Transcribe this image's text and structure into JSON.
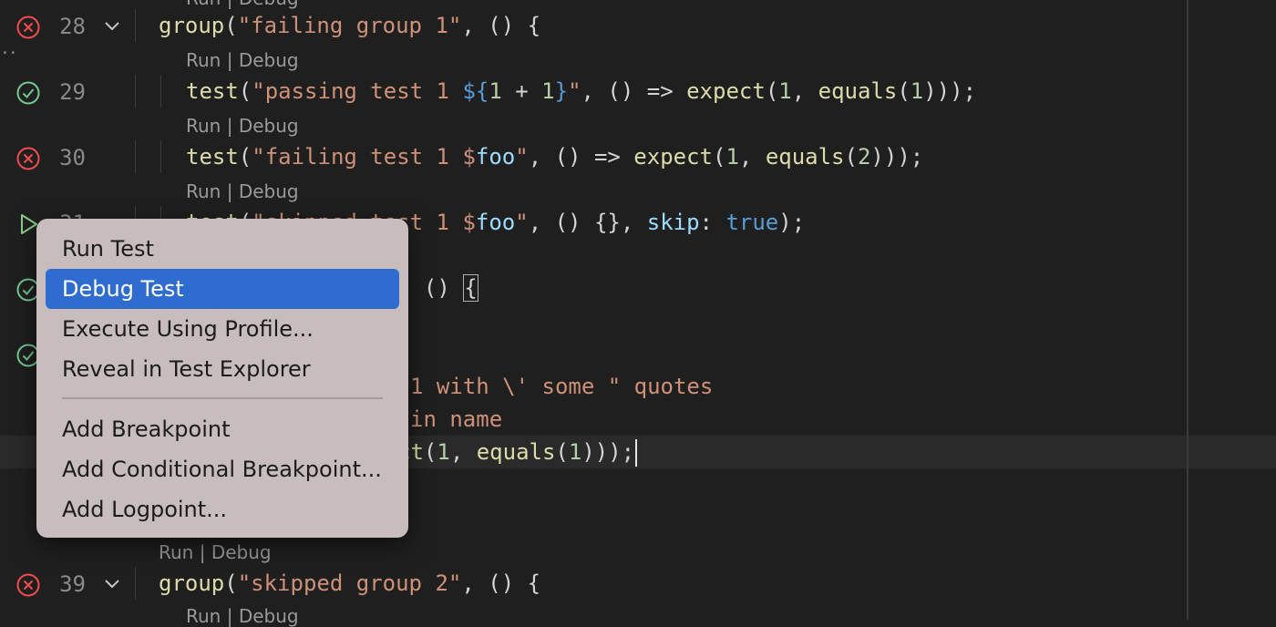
{
  "editor": {
    "lines": [
      {
        "num": "28",
        "status": "failed",
        "text": "group(\"failing group 1\", () {"
      },
      {
        "num": "29",
        "status": "passed",
        "text": "test(\"passing test 1 ${1 + 1}\", () => expect(1, equals(1)));"
      },
      {
        "num": "30",
        "status": "failed",
        "text": "test(\"failing test 1 $foo\", () => expect(1, equals(2)));"
      },
      {
        "num": "31",
        "status": "not-run",
        "text": "test(\"skipped test 1 $foo\", () {}, skip: true);"
      },
      {
        "num": "39",
        "status": "failed",
        "text": "group(\"skipped group 2\", () {"
      }
    ],
    "partial_lines": [
      ", () {",
      "1 with \\' some \" quotes",
      "in name",
      "ct(1, equals(1)));"
    ],
    "codelens": {
      "run": "Run",
      "sep": " | ",
      "debug": "Debug"
    }
  },
  "context_menu": {
    "items": [
      "Run Test",
      "Debug Test",
      "Execute Using Profile...",
      "Reveal in Test Explorer"
    ],
    "breakpoint_items": [
      "Add Breakpoint",
      "Add Conditional Breakpoint...",
      "Add Logpoint..."
    ],
    "selected": "Debug Test"
  },
  "colors": {
    "failed": "#f14c4c",
    "passed": "#73c991",
    "not_run": "#89d185",
    "selection": "#2f6cd0"
  },
  "icons": [
    "error-circle-icon",
    "check-circle-icon",
    "play-icon",
    "chevron-down-icon"
  ]
}
